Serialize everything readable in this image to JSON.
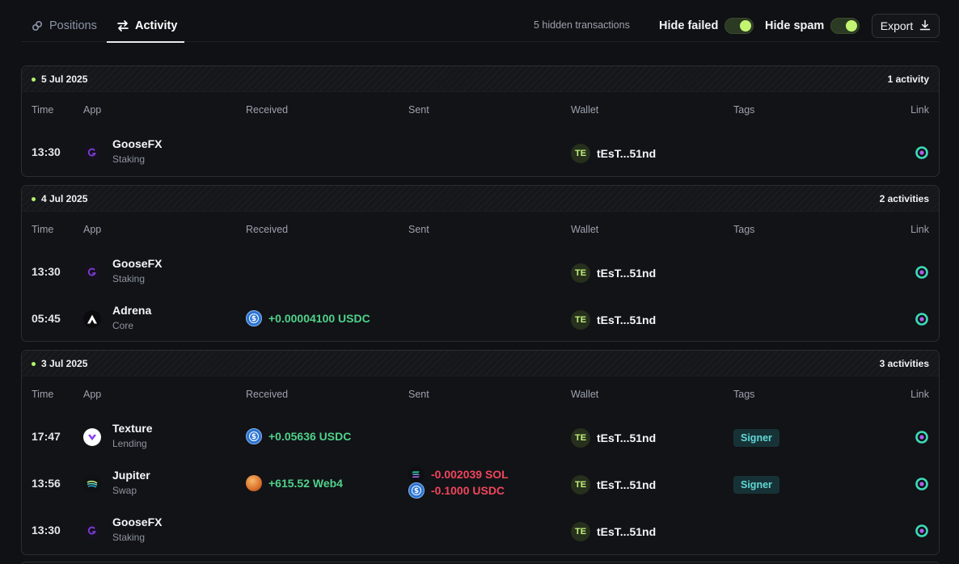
{
  "tabs": {
    "positions": "Positions",
    "activity": "Activity"
  },
  "toolbar": {
    "hidden_transactions": "5 hidden transactions",
    "hide_failed": "Hide failed",
    "hide_spam": "Hide spam",
    "export": "Export",
    "hide_failed_on": true,
    "hide_spam_on": true
  },
  "columns": {
    "time": "Time",
    "app": "App",
    "received": "Received",
    "sent": "Sent",
    "wallet": "Wallet",
    "tags": "Tags",
    "link": "Link"
  },
  "colors": {
    "accent": "#c3f572",
    "received": "#4fd28a",
    "sent": "#f0455c",
    "tag": "#61d8d6",
    "link": "#3ddbb8"
  },
  "groups": [
    {
      "date": "5 Jul 2025",
      "count": "1 activity",
      "rows": [
        {
          "time": "13:30",
          "app": "GooseFX",
          "app_sub": "Staking",
          "app_icon": "goosefx-icon",
          "wallet_avatar": "TE",
          "wallet": "tEsT...51nd"
        }
      ]
    },
    {
      "date": "4 Jul 2025",
      "count": "2 activities",
      "rows": [
        {
          "time": "13:30",
          "app": "GooseFX",
          "app_sub": "Staking",
          "app_icon": "goosefx-icon",
          "wallet_avatar": "TE",
          "wallet": "tEsT...51nd"
        },
        {
          "time": "05:45",
          "app": "Adrena",
          "app_sub": "Core",
          "app_icon": "adrena-icon",
          "received": "+0.00004100 USDC",
          "received_icon": "usdc-icon",
          "wallet_avatar": "TE",
          "wallet": "tEsT...51nd"
        }
      ]
    },
    {
      "date": "3 Jul 2025",
      "count": "3 activities",
      "rows": [
        {
          "time": "17:47",
          "app": "Texture",
          "app_sub": "Lending",
          "app_icon": "texture-icon",
          "received": "+0.05636 USDC",
          "received_icon": "usdc-icon",
          "wallet_avatar": "TE",
          "wallet": "tEsT...51nd",
          "tag": "Signer"
        },
        {
          "time": "13:56",
          "app": "Jupiter",
          "app_sub": "Swap",
          "app_icon": "jupiter-icon",
          "received": "+615.52 Web4",
          "received_icon": "web4-icon",
          "sent": [
            "-0.002039 SOL",
            "-0.1000 USDC"
          ],
          "wallet_avatar": "TE",
          "wallet": "tEsT...51nd",
          "tag": "Signer"
        },
        {
          "time": "13:30",
          "app": "GooseFX",
          "app_sub": "Staking",
          "app_icon": "goosefx-icon",
          "wallet_avatar": "TE",
          "wallet": "tEsT...51nd"
        }
      ]
    }
  ]
}
